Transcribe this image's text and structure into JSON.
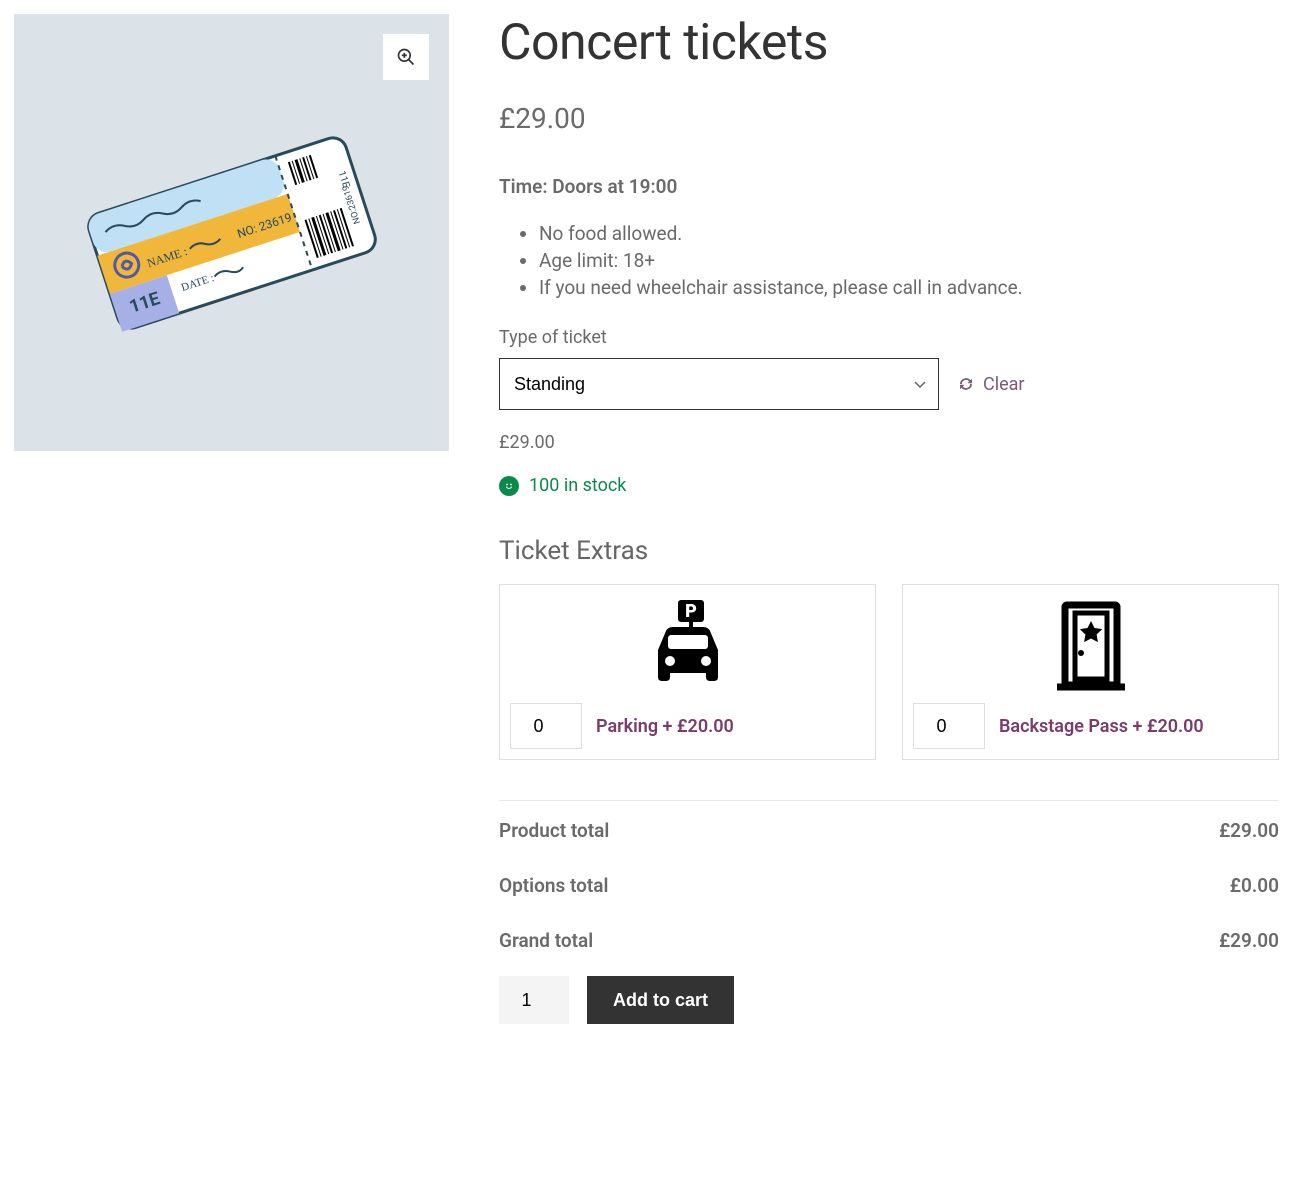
{
  "product": {
    "title": "Concert tickets",
    "price_display": "£29.00",
    "time_line": "Time: Doors at 19:00",
    "rules": [
      "No food allowed.",
      "Age limit: 18+",
      "If you need wheelchair assistance, please call in advance."
    ],
    "variation": {
      "label": "Type of ticket",
      "selected": "Standing",
      "clear_label": "Clear",
      "price_display": "£29.00"
    },
    "stock_text": "100 in stock"
  },
  "extras": {
    "heading": "Ticket Extras",
    "items": [
      {
        "id": "parking",
        "qty": "0",
        "label": "Parking + £20.00"
      },
      {
        "id": "backstage",
        "qty": "0",
        "label": "Backstage Pass + £20.00"
      }
    ]
  },
  "totals": {
    "rows": [
      {
        "label": "Product total",
        "value": "£29.00"
      },
      {
        "label": "Options total",
        "value": "£0.00"
      },
      {
        "label": "Grand total",
        "value": "£29.00"
      }
    ]
  },
  "cart": {
    "quantity": "1",
    "button": "Add to cart"
  },
  "colors": {
    "accent_link": "#7b3b6b",
    "stock_green": "#0a8a4a"
  }
}
